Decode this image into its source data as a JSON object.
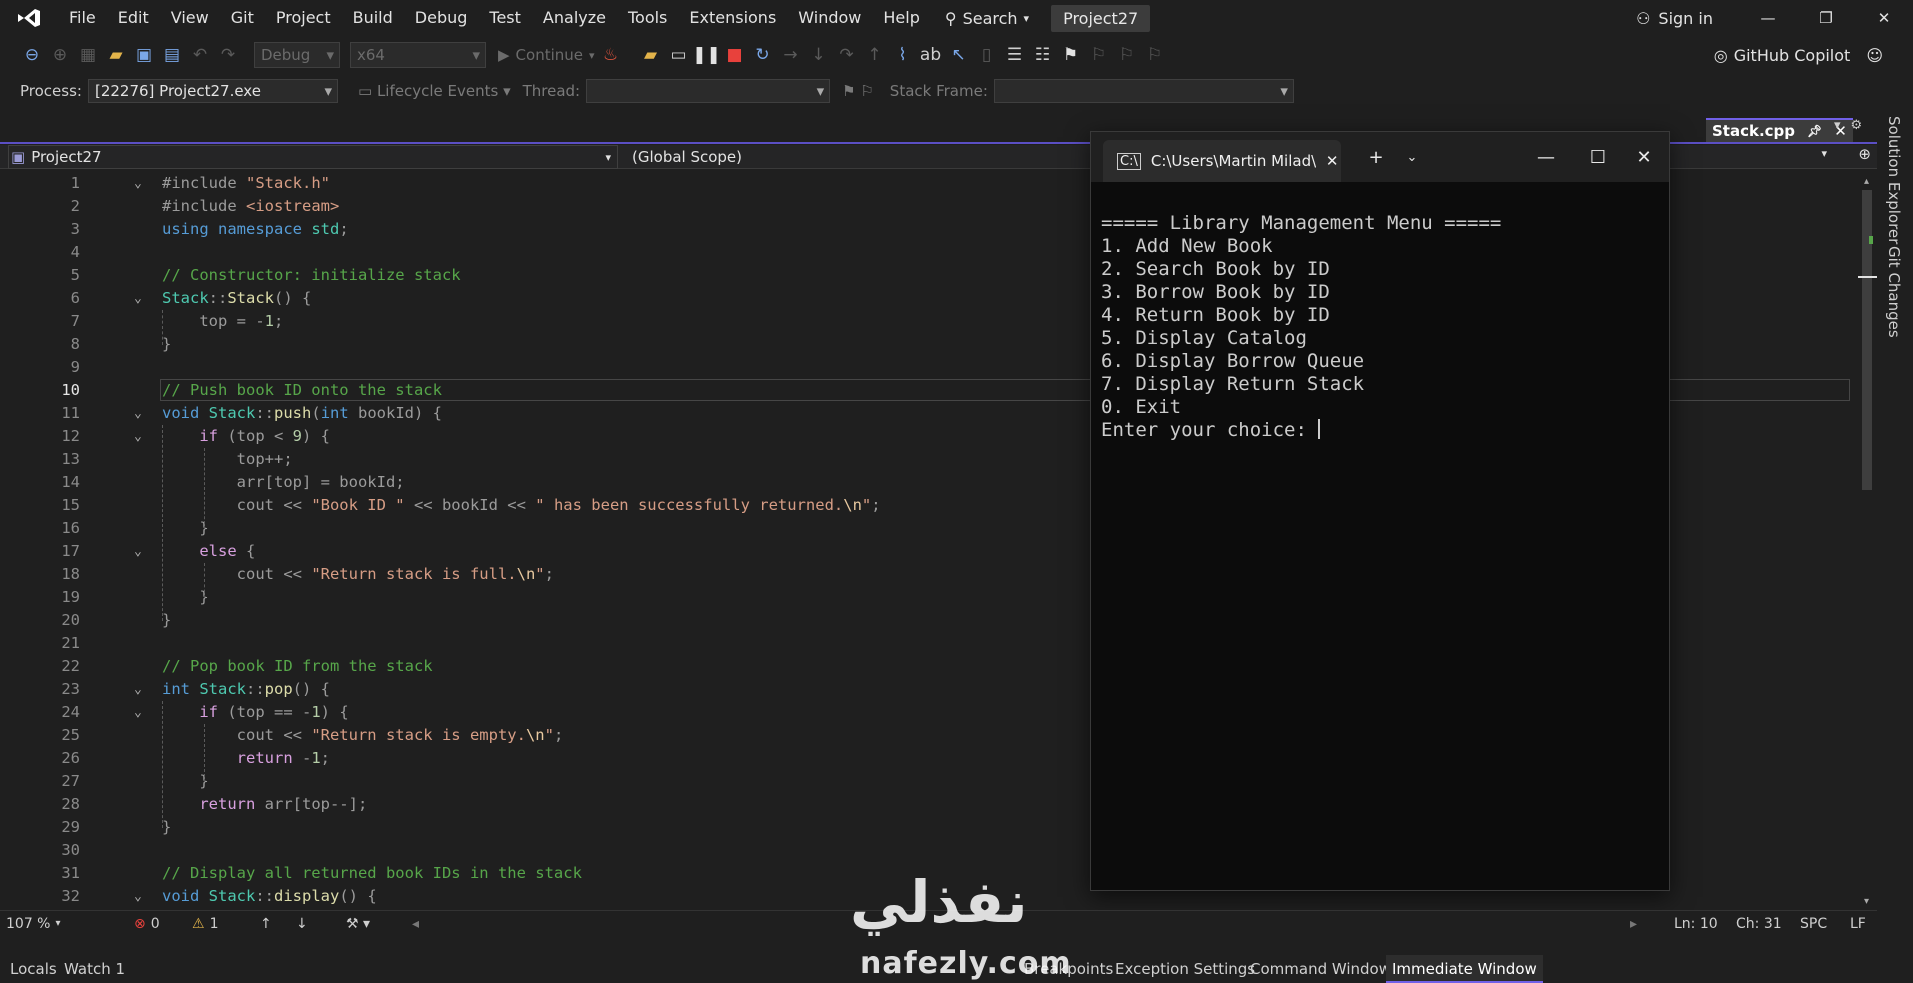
{
  "menubar": {
    "items": [
      "File",
      "Edit",
      "View",
      "Git",
      "Project",
      "Build",
      "Debug",
      "Test",
      "Analyze",
      "Tools",
      "Extensions",
      "Window",
      "Help"
    ],
    "search_label": "Search",
    "project_title": "Project27",
    "signin_label": "Sign in"
  },
  "toolbar": {
    "config": "Debug",
    "platform": "x64",
    "continue_label": "Continue",
    "copilot_label": "GitHub Copilot"
  },
  "debugbar": {
    "process_label": "Process:",
    "process_value": "[22276] Project27.exe",
    "lifecycle_label": "Lifecycle Events",
    "thread_label": "Thread:",
    "stack_frame_label": "Stack Frame:"
  },
  "document_tab": {
    "name": "Stack.cpp"
  },
  "navbar": {
    "project": "Project27",
    "scope": "(Global Scope)"
  },
  "editor": {
    "active_line": 10,
    "lines": [
      {
        "n": "1",
        "fold": "⌄"
      },
      {
        "n": "2",
        "fold": ""
      },
      {
        "n": "3",
        "fold": ""
      },
      {
        "n": "4",
        "fold": ""
      },
      {
        "n": "5",
        "fold": ""
      },
      {
        "n": "6",
        "fold": "⌄"
      },
      {
        "n": "7",
        "fold": ""
      },
      {
        "n": "8",
        "fold": ""
      },
      {
        "n": "9",
        "fold": ""
      },
      {
        "n": "10",
        "fold": ""
      },
      {
        "n": "11",
        "fold": "⌄"
      },
      {
        "n": "12",
        "fold": "⌄"
      },
      {
        "n": "13",
        "fold": ""
      },
      {
        "n": "14",
        "fold": ""
      },
      {
        "n": "15",
        "fold": ""
      },
      {
        "n": "16",
        "fold": ""
      },
      {
        "n": "17",
        "fold": "⌄"
      },
      {
        "n": "18",
        "fold": ""
      },
      {
        "n": "19",
        "fold": ""
      },
      {
        "n": "20",
        "fold": ""
      },
      {
        "n": "21",
        "fold": ""
      },
      {
        "n": "22",
        "fold": ""
      },
      {
        "n": "23",
        "fold": "⌄"
      },
      {
        "n": "24",
        "fold": "⌄"
      },
      {
        "n": "25",
        "fold": ""
      },
      {
        "n": "26",
        "fold": ""
      },
      {
        "n": "27",
        "fold": ""
      },
      {
        "n": "28",
        "fold": ""
      },
      {
        "n": "29",
        "fold": ""
      },
      {
        "n": "30",
        "fold": ""
      },
      {
        "n": "31",
        "fold": ""
      },
      {
        "n": "32",
        "fold": "⌄"
      }
    ],
    "code": [
      [
        [
          "pp",
          "#include "
        ],
        [
          "s",
          "\"Stack.h\""
        ]
      ],
      [
        [
          "pp",
          "#include "
        ],
        [
          "s",
          "<iostream>"
        ]
      ],
      [
        [
          "k",
          "using namespace "
        ],
        [
          "t",
          "std"
        ],
        [
          "p",
          ";"
        ]
      ],
      [],
      [
        [
          "c",
          "// Constructor: initialize stack"
        ]
      ],
      [
        [
          "t",
          "Stack"
        ],
        [
          "p",
          "::"
        ],
        [
          "f",
          "Stack"
        ],
        [
          "p",
          "() {"
        ]
      ],
      [
        [
          "p",
          "    "
        ],
        [
          "n2",
          "top"
        ],
        [
          "p",
          " = -"
        ],
        [
          "n",
          "1"
        ],
        [
          "p",
          ";"
        ]
      ],
      [
        [
          "p",
          "}"
        ]
      ],
      [],
      [
        [
          "c",
          "// Push book ID onto the stack"
        ]
      ],
      [
        [
          "k",
          "void "
        ],
        [
          "t",
          "Stack"
        ],
        [
          "p",
          "::"
        ],
        [
          "f",
          "push"
        ],
        [
          "p",
          "("
        ],
        [
          "k",
          "int "
        ],
        [
          "p",
          "bookId) {"
        ]
      ],
      [
        [
          "p",
          "    "
        ],
        [
          "ctl",
          "if "
        ],
        [
          "p",
          "(top < "
        ],
        [
          "n",
          "9"
        ],
        [
          "p",
          ") {"
        ]
      ],
      [
        [
          "p",
          "        top++;"
        ]
      ],
      [
        [
          "p",
          "        arr[top] = bookId;"
        ]
      ],
      [
        [
          "p",
          "        cout << "
        ],
        [
          "s",
          "\"Book ID \""
        ],
        [
          "p",
          " << bookId << "
        ],
        [
          "s",
          "\" has been successfully returned."
        ],
        [
          "esc",
          "\\n"
        ],
        [
          "s",
          "\""
        ],
        [
          "p",
          ";"
        ]
      ],
      [
        [
          "p",
          "    }"
        ]
      ],
      [
        [
          "p",
          "    "
        ],
        [
          "ctl",
          "else "
        ],
        [
          "p",
          "{"
        ]
      ],
      [
        [
          "p",
          "        cout << "
        ],
        [
          "s",
          "\"Return stack is full."
        ],
        [
          "esc",
          "\\n"
        ],
        [
          "s",
          "\""
        ],
        [
          "p",
          ";"
        ]
      ],
      [
        [
          "p",
          "    }"
        ]
      ],
      [
        [
          "p",
          "}"
        ]
      ],
      [],
      [
        [
          "c",
          "// Pop book ID from the stack"
        ]
      ],
      [
        [
          "k",
          "int "
        ],
        [
          "t",
          "Stack"
        ],
        [
          "p",
          "::"
        ],
        [
          "f",
          "pop"
        ],
        [
          "p",
          "() {"
        ]
      ],
      [
        [
          "p",
          "    "
        ],
        [
          "ctl",
          "if "
        ],
        [
          "p",
          "(top == -"
        ],
        [
          "n",
          "1"
        ],
        [
          "p",
          ") {"
        ]
      ],
      [
        [
          "p",
          "        cout << "
        ],
        [
          "s",
          "\"Return stack is empty."
        ],
        [
          "esc",
          "\\n"
        ],
        [
          "s",
          "\""
        ],
        [
          "p",
          ";"
        ]
      ],
      [
        [
          "p",
          "        "
        ],
        [
          "ctl",
          "return "
        ],
        [
          "p",
          "-"
        ],
        [
          "n",
          "1"
        ],
        [
          "p",
          ";"
        ]
      ],
      [
        [
          "p",
          "    }"
        ]
      ],
      [
        [
          "p",
          "    "
        ],
        [
          "ctl",
          "return "
        ],
        [
          "p",
          "arr[top--];"
        ]
      ],
      [
        [
          "p",
          "}"
        ]
      ],
      [],
      [
        [
          "c",
          "// Display all returned book IDs in the stack"
        ]
      ],
      [
        [
          "k",
          "void "
        ],
        [
          "t",
          "Stack"
        ],
        [
          "p",
          "::"
        ],
        [
          "f",
          "display"
        ],
        [
          "p",
          "() {"
        ]
      ]
    ]
  },
  "terminal": {
    "tab_title": "C:\\Users\\Martin Milad\\s",
    "output": "===== Library Management Menu =====\n1. Add New Book\n2. Search Book by ID\n3. Borrow Book by ID\n4. Return Book by ID\n5. Display Catalog\n6. Display Borrow Queue\n7. Display Return Stack\n0. Exit\nEnter your choice: "
  },
  "statusbar": {
    "zoom": "107 %",
    "errors": "0",
    "warnings": "1",
    "line": "Ln: 10",
    "col": "Ch: 31",
    "spacing": "SPC",
    "eol": "LF"
  },
  "side_panels": [
    "Solution Explorer",
    "Git Changes"
  ],
  "bottom_tabs": [
    "Locals",
    "Watch 1",
    "Breakpoints",
    "Exception Settings",
    "Command Window",
    "Immediate Window"
  ],
  "watermark": {
    "arabic": "نفذلي",
    "latin": "nafezly.com"
  },
  "colors": {
    "accent": "#7160e8",
    "comment": "#57a64a",
    "keyword": "#569cd6",
    "string": "#d69d85",
    "type": "#4ec9b0"
  }
}
